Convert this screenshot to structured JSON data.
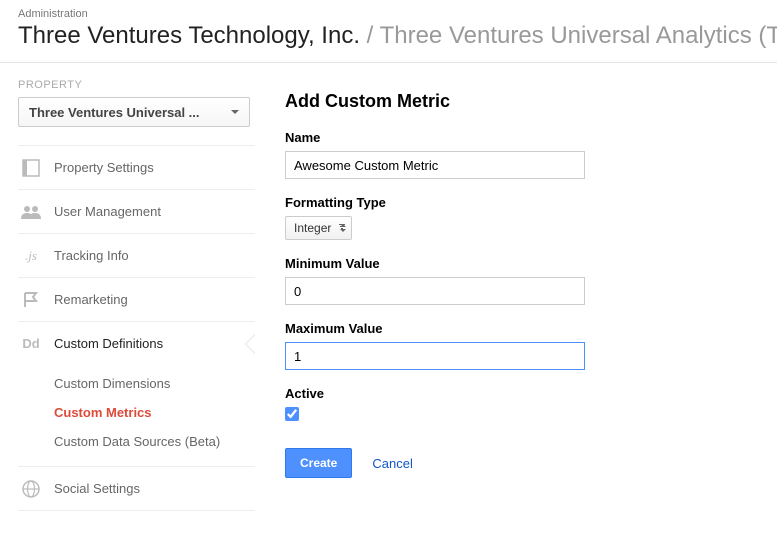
{
  "header": {
    "breadcrumb": "Administration",
    "account_name": "Three Ventures Technology, Inc.",
    "separator": " / ",
    "property_name": "Three Ventures Universal Analytics (TM)"
  },
  "sidebar": {
    "property_label": "PROPERTY",
    "property_value": "Three Ventures Universal ...",
    "items": [
      {
        "label": "Property Settings"
      },
      {
        "label": "User Management"
      },
      {
        "label": "Tracking Info"
      },
      {
        "label": "Remarketing"
      },
      {
        "label": "Custom Definitions"
      },
      {
        "label": "Social Settings"
      }
    ],
    "subitems": [
      {
        "label": "Custom Dimensions"
      },
      {
        "label": "Custom Metrics"
      },
      {
        "label": "Custom Data Sources (Beta)"
      }
    ]
  },
  "form": {
    "page_title": "Add Custom Metric",
    "name_label": "Name",
    "name_value": "Awesome Custom Metric",
    "formatting_label": "Formatting Type",
    "formatting_value": "Integer",
    "min_label": "Minimum Value",
    "min_value": "0",
    "max_label": "Maximum Value",
    "max_value": "1",
    "active_label": "Active",
    "active_checked": true,
    "create_label": "Create",
    "cancel_label": "Cancel"
  }
}
